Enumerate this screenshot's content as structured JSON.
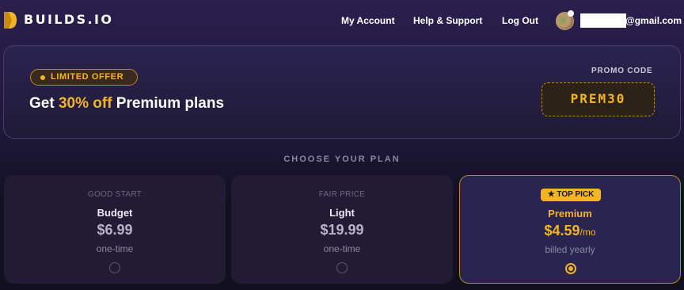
{
  "header": {
    "brand": "BUILDS.IO",
    "nav": [
      "My Account",
      "Help & Support",
      "Log Out"
    ],
    "user_email": "@gmail.com"
  },
  "banner": {
    "badge": "LIMITED OFFER",
    "title_pre": "Get ",
    "title_highlight": "30% off",
    "title_post": " Premium plans",
    "promo_label": "PROMO CODE",
    "promo_code": "PREM30"
  },
  "plans_section": {
    "title": "CHOOSE YOUR PLAN",
    "plans": [
      {
        "tag": "GOOD START",
        "name": "Budget",
        "price": "$6.99",
        "per": "",
        "billing": "one-time",
        "selected": false
      },
      {
        "tag": "FAIR PRICE",
        "name": "Light",
        "price": "$19.99",
        "per": "",
        "billing": "one-time",
        "selected": false
      },
      {
        "tag": "★ TOP PICK",
        "name": "Premium",
        "price": "$4.59",
        "per": "/mo",
        "billing": "billed yearly",
        "selected": true
      }
    ]
  },
  "colors": {
    "accent": "#f5b520",
    "background": "#120f1f",
    "card": "#211c33"
  }
}
